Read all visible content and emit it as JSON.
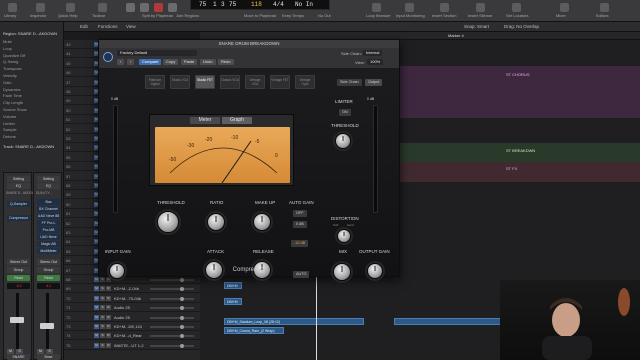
{
  "control_bar": {
    "buttons": [
      {
        "id": "library",
        "label": "Library"
      },
      {
        "id": "inspector",
        "label": "Inspector"
      },
      {
        "id": "quick-help",
        "label": "Quick Help"
      },
      {
        "id": "toolbar",
        "label": "Toolbar"
      },
      {
        "id": "smart-controls",
        "label": "Smart Controls"
      },
      {
        "id": "mixer",
        "label": "Mixer"
      },
      {
        "id": "editors",
        "label": "Editors"
      }
    ],
    "right_buttons": [
      {
        "id": "split-by-playhead",
        "label": "Split by Playhead"
      },
      {
        "id": "join-regions",
        "label": "Join Regions"
      },
      {
        "id": "mute-to-playhead",
        "label": "Move to Playhead"
      },
      {
        "id": "keep-tempo",
        "label": "Keep Tempo"
      },
      {
        "id": "no-out",
        "label": "No Out"
      },
      {
        "id": "loop-browser",
        "label": "Loop Browser"
      },
      {
        "id": "input-monitoring",
        "label": "Input Monitoring"
      },
      {
        "id": "insert-section",
        "label": "Insert Section"
      },
      {
        "id": "insert-silence",
        "label": "Insert Silence"
      },
      {
        "id": "set-locators",
        "label": "Set Locators"
      }
    ],
    "lcd": {
      "bar": "75",
      "beat": "1",
      "div": "3",
      "tick": "75",
      "tempo": "118",
      "sig": "4/4",
      "key": "No In"
    }
  },
  "inspector": {
    "region_title": "Region: SNARE D...AKDOWN",
    "lines": [
      "Mute",
      "Loop",
      "Quantize  Off",
      "Q-Swing",
      "Transpose",
      "Velocity",
      "Gain",
      "Dynamics",
      "Fade Time",
      "Clip Length",
      "Source  Show",
      "Volume",
      "Limiter",
      "Sample",
      "Detune"
    ],
    "track_label": "Track: SNARE D...AKDOWN",
    "strip_left": {
      "name": "SNARE D...AKDOWN",
      "setting": "Setting",
      "eq": "EQ",
      "slots": [
        "Q-Sampler",
        "Compressor"
      ],
      "output": "Stereo Out",
      "group": "Group",
      "read": "Read",
      "value": "-3.2",
      "mute": "M",
      "solo": "S",
      "bottom": "SNARE"
    },
    "strip_right": {
      "name": "DUALITY...",
      "setting": "Setting",
      "eq": "EQ",
      "slots": [
        "Bus",
        "BX Channel",
        "UAD Neve 88",
        "FF Pro-L",
        "Pro-MB",
        "UAD Neve",
        "Magic AB",
        "MultiMeter"
      ],
      "output": "Stereo Out",
      "group": "Group",
      "read": "Read",
      "value": "4.1",
      "mute": "M",
      "solo": "S",
      "bottom": "Bnce"
    }
  },
  "tracks_area": {
    "toolbar": [
      "Edit",
      "Functions",
      "View"
    ],
    "snap": "Snap: Smart",
    "drag": "Drag: No Overlap",
    "marker": "Marker 4",
    "rows": [
      {
        "num": "43"
      },
      {
        "num": "44"
      },
      {
        "num": "45"
      },
      {
        "num": "46"
      },
      {
        "num": "47"
      },
      {
        "num": "48"
      },
      {
        "num": "49"
      },
      {
        "num": "50"
      },
      {
        "num": "51"
      },
      {
        "num": "52"
      },
      {
        "num": "53"
      },
      {
        "num": "54"
      },
      {
        "num": "55"
      },
      {
        "num": "56"
      },
      {
        "num": "57"
      },
      {
        "num": "58"
      },
      {
        "num": "59"
      },
      {
        "num": "60"
      },
      {
        "num": "61"
      },
      {
        "num": "62"
      },
      {
        "num": "63"
      },
      {
        "num": "64"
      },
      {
        "num": "65"
      },
      {
        "num": "66"
      },
      {
        "num": "67"
      },
      {
        "num": "68"
      },
      {
        "num": "69",
        "name": "KD+M...Z-04b"
      },
      {
        "num": "70",
        "name": "KD+M...70-04b"
      },
      {
        "num": "71",
        "name": "Audio 25"
      },
      {
        "num": "72",
        "name": "Audio 25"
      },
      {
        "num": "73",
        "name": "KD+M...DE,124"
      },
      {
        "num": "74",
        "name": "KD+M...d_Rear"
      },
      {
        "num": "75",
        "name": "WASTE...UT 1-2"
      }
    ],
    "markers": [
      "ST CHORUS",
      "ST BREAKDWN",
      "ST FX"
    ],
    "regions": [
      "DBl+M",
      "DBl+M",
      "DBl+M_Stadium_Loop_08 (28:12)",
      "DBl+M_Crowd_Ram_(2 Wrap)"
    ]
  },
  "plugin": {
    "title": "SNARE DRUM BREAKDOWN",
    "preset": "Factory Default",
    "nav": [
      "Compare",
      "Copy",
      "Paste",
      "Undo",
      "Redo"
    ],
    "side_chain_label": "Side Chain:",
    "side_chain_value": "Internal",
    "view_label": "View:",
    "view_value": "100%",
    "models": [
      "Platinum Digital",
      "Studio VCA",
      "Studio FET",
      "Classic VCA",
      "Vintage VCA",
      "Vintage FET",
      "Vintage Opto"
    ],
    "selected_model": "Studio FET",
    "side_chain_btn": "Side Chain",
    "output_btn": "Output",
    "meter_tabs": [
      "Meter",
      "Graph"
    ],
    "vu_scale": [
      "-50",
      "-30",
      "-20",
      "-10",
      "-5",
      "0"
    ],
    "input_gain_label": "INPUT GAIN",
    "input_gain_top": "0 dB",
    "threshold_label": "THRESHOLD",
    "ratio_label": "RATIO",
    "makeup_label": "MAKE UP",
    "autogain_label": "AUTO GAIN",
    "autogain_opts": [
      "OFF",
      "0 dB",
      "-12 dB"
    ],
    "attack_label": "ATTACK",
    "release_label": "RELEASE",
    "auto_btn": "AUTO",
    "limiter_label": "LIMITER",
    "limiter_on": "ON",
    "limiter_threshold": "THRESHOLD",
    "distortion_label": "DISTORTION",
    "distortion_opts": [
      "Soft",
      "Hard",
      "Clip"
    ],
    "mix_label": "MIX",
    "output_gain_label": "OUTPUT GAIN",
    "footer": "Compressor",
    "output_top": "0 dB"
  },
  "colors": {
    "accent": "#3d6fb0",
    "vu_face": "#e09a48",
    "region": "#2b5a88",
    "marker_band": "#6b3a6a"
  }
}
